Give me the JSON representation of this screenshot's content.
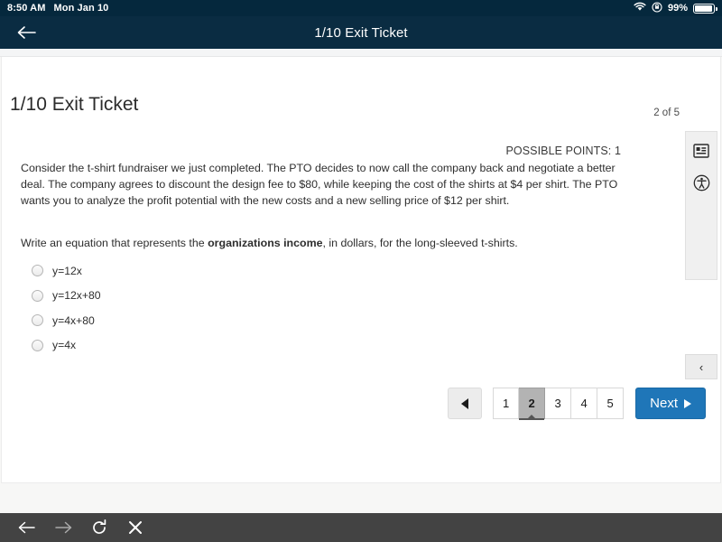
{
  "status_bar": {
    "time": "8:50 AM",
    "date": "Mon Jan 10",
    "battery_percent": "99%",
    "wifi_icon": "wifi-icon",
    "rotation_lock_icon": "rotation-lock-icon",
    "battery_icon": "battery-icon"
  },
  "app_bar": {
    "back_icon": "back-arrow-icon",
    "title": "1/10 Exit Ticket"
  },
  "assignment": {
    "title": "1/10 Exit Ticket",
    "page_count": "2 of 5",
    "possible_points": "POSSIBLE POINTS: 1",
    "stimulus": "Consider the t-shirt fundraiser we just completed. The PTO decides to now call the company back and negotiate a better deal. The company agrees to discount the design fee to $80, while keeping the cost of the shirts at $4 per shirt. The PTO wants you to analyze the profit potential with the new costs and a new selling price of $12 per shirt.",
    "prompt_before": "Write an equation that represents the ",
    "prompt_bold": "organizations income",
    "prompt_after": ", in dollars, for the long-sleeved t-shirts.",
    "choices": [
      {
        "label": "y=12x",
        "selected": false
      },
      {
        "label": "y=12x+80",
        "selected": false
      },
      {
        "label": "y=4x+80",
        "selected": false
      },
      {
        "label": "y=4x",
        "selected": false
      }
    ]
  },
  "tool_panel": {
    "items": [
      {
        "icon": "reference-sheet-icon"
      },
      {
        "icon": "accessibility-icon"
      }
    ],
    "collapse_label": "‹"
  },
  "pagination": {
    "prev_icon": "previous-triangle-icon",
    "pages": [
      "1",
      "2",
      "3",
      "4",
      "5"
    ],
    "active_page": "2",
    "next_label": "Next",
    "next_icon": "next-triangle-icon"
  },
  "browser_toolbar": {
    "back_icon": "browser-back-icon",
    "forward_icon": "browser-forward-icon",
    "reload_icon": "reload-icon",
    "close_icon": "close-icon"
  },
  "colors": {
    "status_bar": "#05283d",
    "app_bar": "#0a2c42",
    "next_button": "#1f76b8",
    "active_page": "#b3b3b3",
    "bottom_bar": "#434343"
  }
}
